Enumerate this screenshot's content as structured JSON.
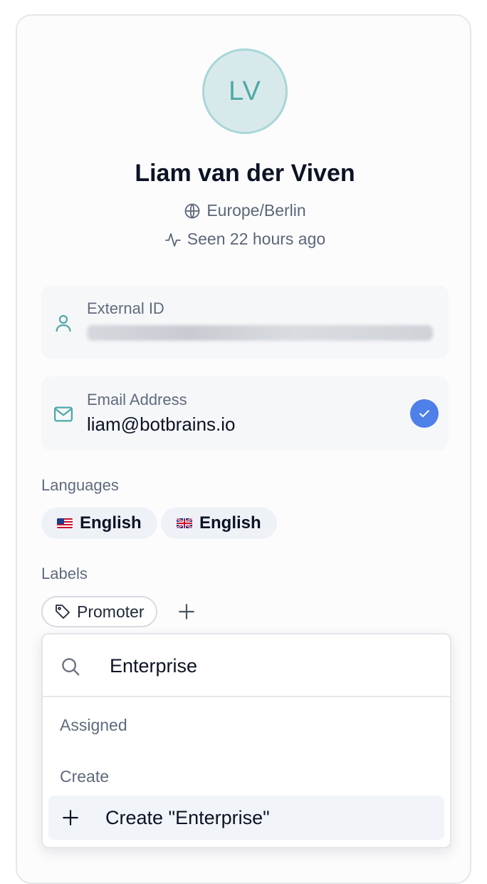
{
  "profile": {
    "initials": "LV",
    "name": "Liam van der Viven",
    "timezone": "Europe/Berlin",
    "last_seen": "Seen 22 hours ago"
  },
  "fields": {
    "external_id": {
      "label": "External ID",
      "value_redacted": true
    },
    "email": {
      "label": "Email Address",
      "value": "liam@botbrains.io",
      "verified": true
    }
  },
  "languages": {
    "label": "Languages",
    "items": [
      {
        "flag": "us-flag-icon",
        "label": "English"
      },
      {
        "flag": "gb-flag-icon",
        "label": "English"
      }
    ]
  },
  "labels": {
    "label": "Labels",
    "items": [
      {
        "icon": "tag-icon",
        "label": "Promoter"
      }
    ],
    "add_icon": "plus-icon"
  },
  "label_picker": {
    "search_value": "Enterprise",
    "groups": {
      "assigned": "Assigned",
      "create": "Create"
    },
    "create_option": "Create \"Enterprise\""
  },
  "colors": {
    "accent": "#4ea8a8",
    "avatar_bg": "#d8e9ec",
    "verified_badge": "#4f7fe8",
    "muted_text": "#5f6b7d"
  }
}
